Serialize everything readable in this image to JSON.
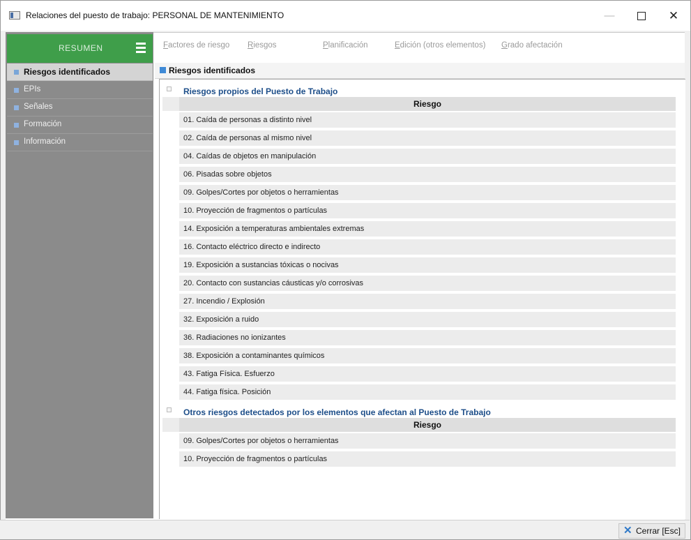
{
  "window": {
    "title": "Relaciones del puesto de trabajo: PERSONAL DE MANTENIMIENTO",
    "minimize": "—",
    "close": "✕"
  },
  "sidebar": {
    "header": "RESUMEN",
    "items": [
      {
        "label": "Riesgos identificados",
        "active": true
      },
      {
        "label": "EPIs",
        "active": false
      },
      {
        "label": "Señales",
        "active": false
      },
      {
        "label": "Formación",
        "active": false
      },
      {
        "label": "Información",
        "active": false
      }
    ]
  },
  "tabs": [
    {
      "first": "F",
      "rest": "actores de riesgo"
    },
    {
      "first": "R",
      "rest": "iesgos"
    },
    {
      "first": "P",
      "rest": "lanificación"
    },
    {
      "first": "E",
      "rest": "dición (otros elementos)"
    },
    {
      "first": "G",
      "rest": "rado afectación"
    }
  ],
  "section": {
    "title": "Riesgos identificados"
  },
  "groups": [
    {
      "title": "Riesgos propios del Puesto de Trabajo",
      "column": "Riesgo",
      "rows": [
        "01. Caída de personas a distinto nivel",
        "02. Caída de personas al mismo nivel",
        "04. Caídas de objetos en manipulación",
        "06. Pisadas sobre objetos",
        "09. Golpes/Cortes por objetos o herramientas",
        "10. Proyección de fragmentos o partículas",
        "14. Exposición a temperaturas ambientales extremas",
        "16. Contacto eléctrico directo e indirecto",
        "19. Exposición a sustancias tóxicas o nocivas",
        "20. Contacto con sustancias cáusticas y/o corrosivas",
        "27. Incendio / Explosión",
        "32. Exposición a ruido",
        "36. Radiaciones no ionizantes",
        "38. Exposición a contaminantes químicos",
        "43. Fatiga Física. Esfuerzo",
        "44. Fatiga física. Posición"
      ]
    },
    {
      "title": "Otros riesgos detectados por los elementos que afectan al Puesto de Trabajo",
      "column": "Riesgo",
      "rows": [
        "09. Golpes/Cortes por objetos o herramientas",
        "10. Proyección de fragmentos o partículas"
      ]
    }
  ],
  "footer": {
    "close_label": "Cerrar  [Esc]"
  },
  "colors": {
    "resumen_green": "#3f9e4a",
    "sidebar_gray": "#8b8b8b",
    "group_title_blue": "#1d4e89",
    "accent_blue": "#3f8ad6"
  }
}
